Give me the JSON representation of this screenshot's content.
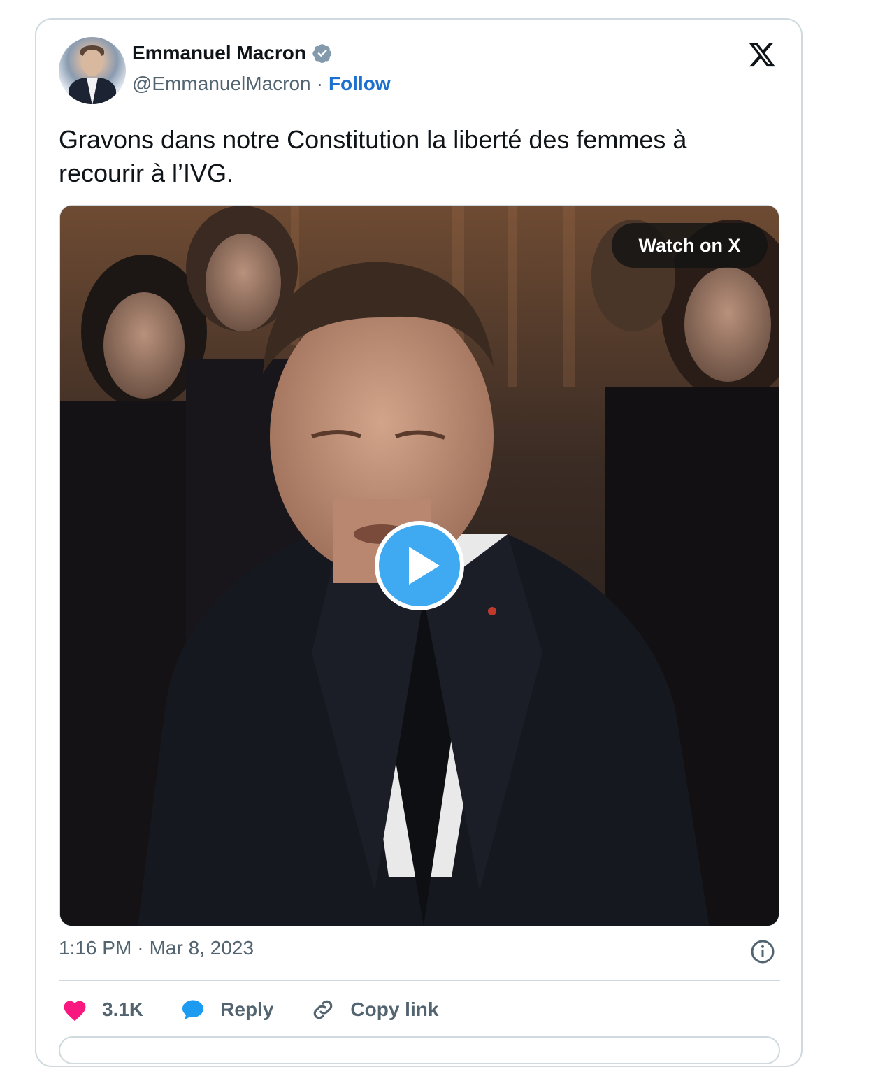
{
  "author": {
    "name": "Emmanuel Macron",
    "handle": "@EmmanuelMacron",
    "separator": "·",
    "follow_label": "Follow"
  },
  "platform_icon": "x-logo-icon",
  "tweet": {
    "text": "Gravons dans notre Constitution la liberté des femmes à recourir à l’IVG."
  },
  "media": {
    "watch_label": "Watch on X",
    "play_icon": "play-icon"
  },
  "meta": {
    "time": "1:16 PM",
    "separator": "·",
    "date": "Mar 8, 2023"
  },
  "actions": {
    "likes": "3.1K",
    "reply_label": "Reply",
    "copy_label": "Copy link"
  },
  "colors": {
    "accent": "#1d9bf0",
    "follow": "#1d6fd0",
    "like": "#f91880",
    "muted": "#536471",
    "border": "#cfd9de"
  }
}
